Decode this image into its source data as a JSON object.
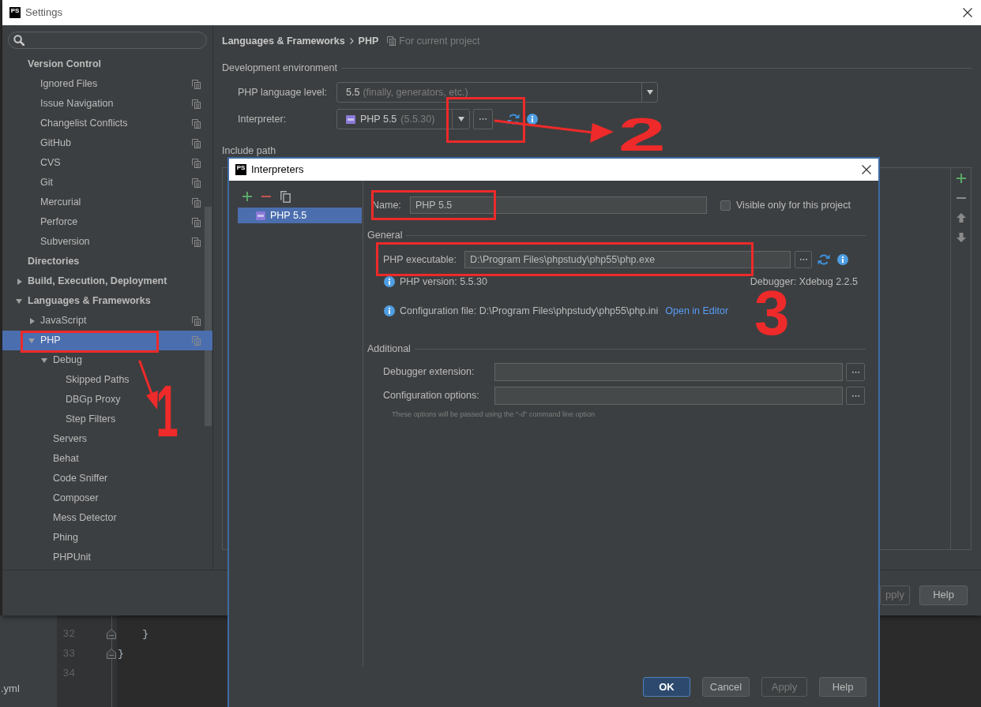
{
  "settings_window": {
    "logo": "PS",
    "title": "Settings"
  },
  "sidebar": {
    "items": [
      {
        "label": "Version Control",
        "selected": false,
        "children": [
          {
            "label": "Ignored Files",
            "selected": false,
            "per_project": true
          },
          {
            "label": "Issue Navigation",
            "selected": false,
            "per_project": true
          },
          {
            "label": "Changelist Conflicts",
            "selected": false,
            "per_project": true
          },
          {
            "label": "GitHub",
            "selected": false,
            "per_project": true
          },
          {
            "label": "CVS",
            "selected": false,
            "per_project": true
          },
          {
            "label": "Git",
            "selected": false,
            "per_project": true
          },
          {
            "label": "Mercurial",
            "selected": false,
            "per_project": true
          },
          {
            "label": "Perforce",
            "selected": false,
            "per_project": true
          },
          {
            "label": "Subversion",
            "selected": false,
            "per_project": true
          }
        ]
      },
      {
        "label": "Directories",
        "selected": false
      },
      {
        "label": "Build, Execution, Deployment",
        "selected": false,
        "expanded": false
      },
      {
        "label": "Languages & Frameworks",
        "selected": false,
        "expanded": true,
        "children": [
          {
            "label": "JavaScript",
            "selected": false,
            "expanded": false,
            "per_project": true
          },
          {
            "label": "PHP",
            "selected": true,
            "expanded": true,
            "per_project": true,
            "children": [
              {
                "label": "Debug",
                "selected": false,
                "expanded": true,
                "children": [
                  {
                    "label": "Skipped Paths",
                    "selected": false
                  },
                  {
                    "label": "DBGp Proxy",
                    "selected": false
                  },
                  {
                    "label": "Step Filters",
                    "selected": false
                  }
                ]
              },
              {
                "label": "Servers",
                "selected": false
              },
              {
                "label": "Behat",
                "selected": false
              },
              {
                "label": "Code Sniffer",
                "selected": false
              },
              {
                "label": "Composer",
                "selected": false
              },
              {
                "label": "Mess Detector",
                "selected": false
              },
              {
                "label": "Phing",
                "selected": false
              },
              {
                "label": "PHPUnit",
                "selected": false
              }
            ]
          }
        ]
      }
    ]
  },
  "breadcrumb": {
    "path": [
      "Languages & Frameworks",
      "PHP"
    ],
    "scope": "For current project"
  },
  "development_environment": {
    "title": "Development environment",
    "language_level": {
      "label": "PHP language level:",
      "value": "5.5",
      "hint": "(finally, generators, etc.)"
    },
    "interpreter": {
      "label": "Interpreter:",
      "value": "PHP 5.5",
      "hint": "(5.5.30)"
    }
  },
  "include_path": {
    "title": "Include path"
  },
  "settings_buttons": [
    {
      "label": "pply",
      "disabled": true
    },
    {
      "label": "Help",
      "disabled": false
    }
  ],
  "editor": {
    "project_file": ".yml",
    "lines": [
      {
        "number": "32",
        "code": "    }",
        "folding": true
      },
      {
        "number": "33",
        "code": "}",
        "folding": true
      },
      {
        "number": "34",
        "folding": false
      }
    ]
  },
  "interpreters_dialog": {
    "logo": "PS",
    "title": "Interpreters",
    "interpreters": [
      {
        "label": "PHP 5.5",
        "selected": true
      }
    ],
    "name": {
      "label": "Name:",
      "value": "PHP 5.5"
    },
    "visible_only": {
      "label": "Visible only for this project",
      "checked": false
    },
    "general": {
      "title": "General",
      "executable": {
        "label": "PHP executable:",
        "value": "D:\\Program Files\\phpstudy\\php55\\php.exe"
      },
      "version": "PHP version: 5.5.30",
      "debugger": "Debugger: Xdebug 2.2.5",
      "config_file": "Configuration file: D:\\Program Files\\phpstudy\\php55\\php.ini",
      "config_link": "Open in Editor"
    },
    "additional": {
      "title": "Additional",
      "fields": [
        {
          "label": "Debugger extension:"
        },
        {
          "label": "Configuration options:"
        }
      ],
      "hint": "These options will be passed using the \"-d\" command line option"
    },
    "buttons": [
      {
        "label": "OK",
        "kind": "default",
        "disabled": false
      },
      {
        "label": "Cancel",
        "kind": "normal",
        "disabled": false
      },
      {
        "label": "Apply",
        "kind": "normal",
        "disabled": true
      },
      {
        "label": "Help",
        "kind": "normal",
        "disabled": false
      }
    ]
  },
  "annotations": {
    "numerals": [
      "1",
      "2",
      "3"
    ]
  }
}
